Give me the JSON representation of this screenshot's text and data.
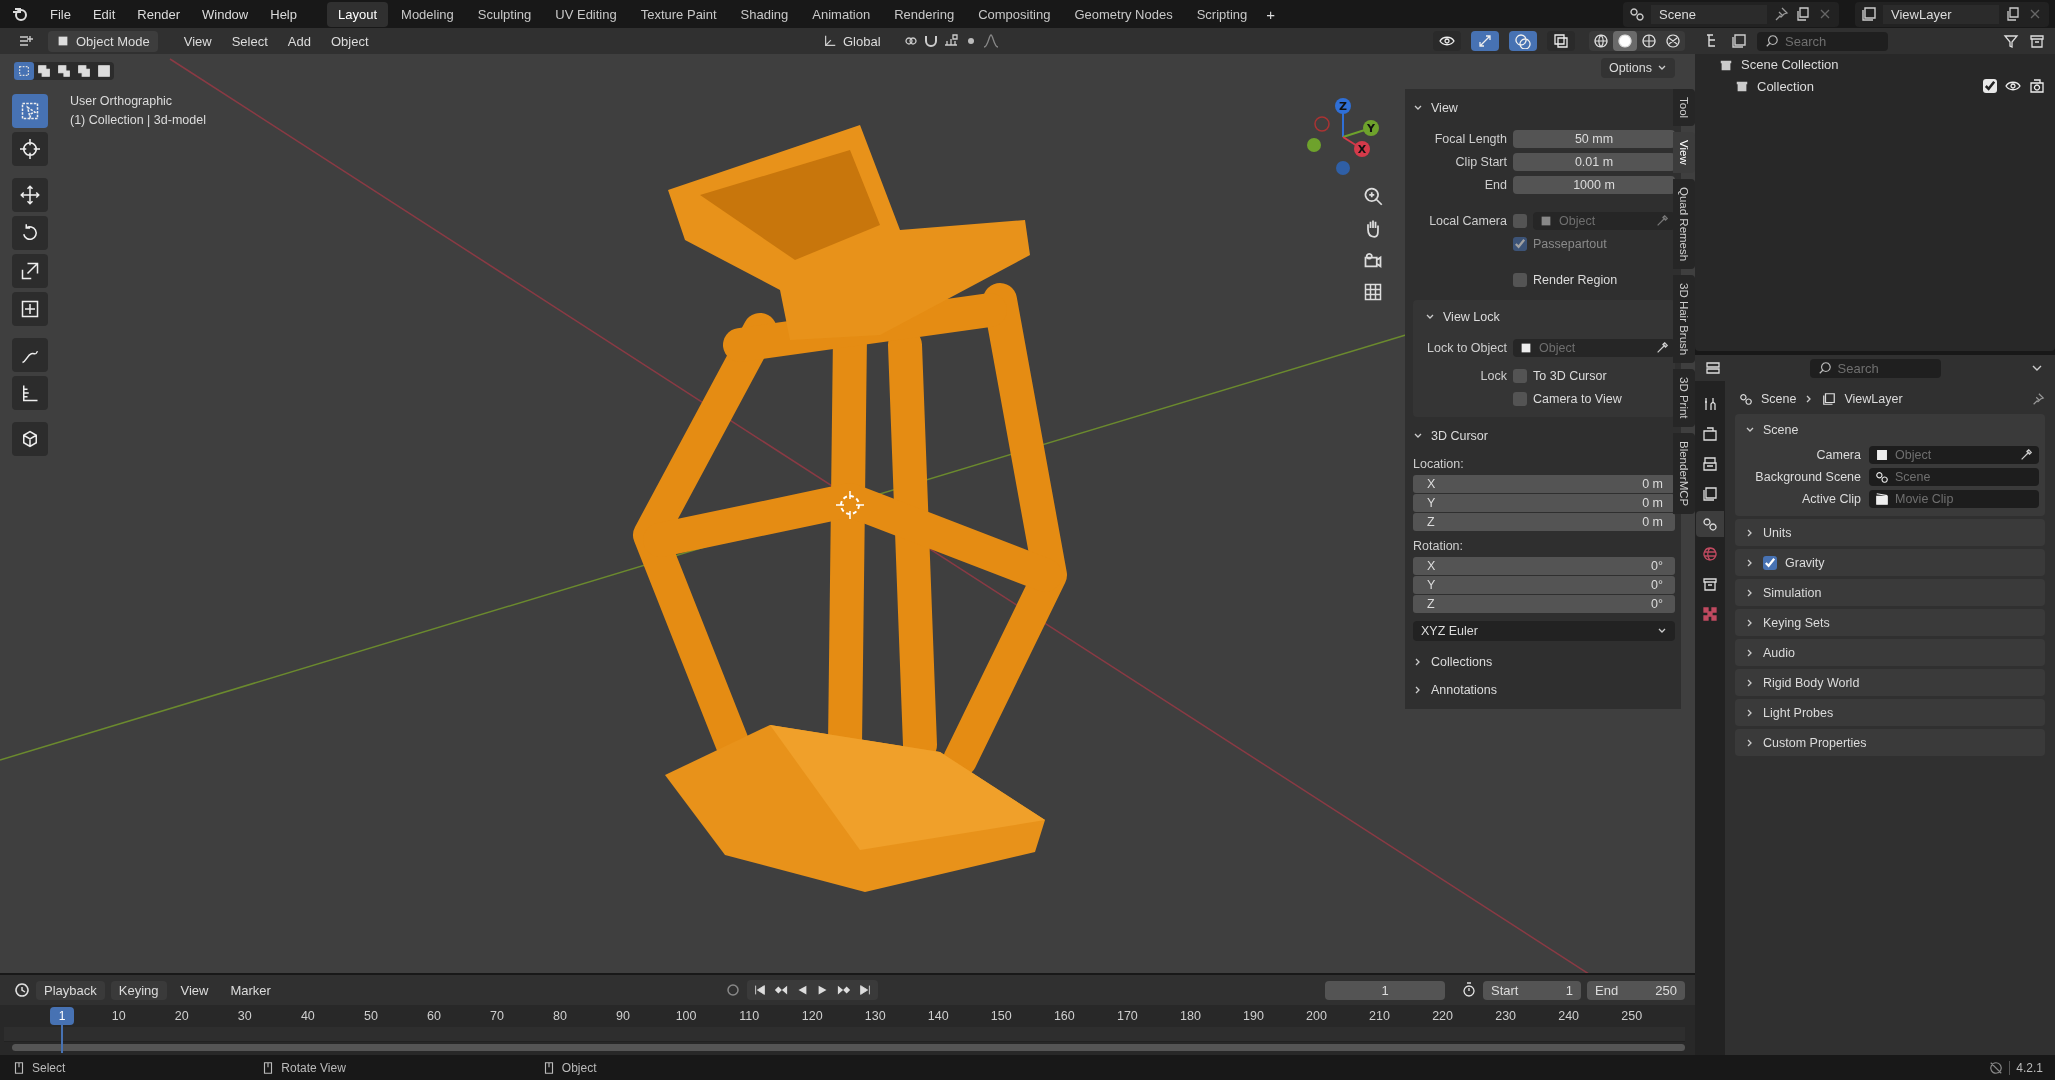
{
  "top_bar": {
    "menus": [
      "File",
      "Edit",
      "Render",
      "Window",
      "Help"
    ],
    "workspaces": [
      {
        "label": "Layout",
        "selected": true
      },
      {
        "label": "Modeling",
        "selected": false
      },
      {
        "label": "Sculpting",
        "selected": false
      },
      {
        "label": "UV Editing",
        "selected": false
      },
      {
        "label": "Texture Paint",
        "selected": false
      },
      {
        "label": "Shading",
        "selected": false
      },
      {
        "label": "Animation",
        "selected": false
      },
      {
        "label": "Rendering",
        "selected": false
      },
      {
        "label": "Compositing",
        "selected": false
      },
      {
        "label": "Geometry Nodes",
        "selected": false
      },
      {
        "label": "Scripting",
        "selected": false
      }
    ],
    "add_workspace": "+",
    "scene": "Scene",
    "view_layer": "ViewLayer"
  },
  "viewport_header": {
    "mode": "Object Mode",
    "menus": [
      "View",
      "Select",
      "Add",
      "Object"
    ],
    "orientation": "Global",
    "toggles": [
      {
        "kind": "visibility",
        "on": false
      },
      {
        "kind": "gizmos",
        "on": true
      },
      {
        "kind": "overlays",
        "on": true
      },
      {
        "kind": "xray",
        "on": false
      }
    ],
    "shading": [
      {
        "kind": "wireframe",
        "selected": false
      },
      {
        "kind": "solid",
        "selected": true
      },
      {
        "kind": "material",
        "selected": false
      },
      {
        "kind": "rendered",
        "selected": false
      }
    ],
    "options": "Options"
  },
  "select_modes": [
    {
      "kind": "new",
      "selected": true
    },
    {
      "kind": "extend",
      "selected": false
    },
    {
      "kind": "subtract",
      "selected": false
    },
    {
      "kind": "invert",
      "selected": false
    },
    {
      "kind": "intersect",
      "selected": false
    }
  ],
  "tools": [
    {
      "kind": "select_box",
      "selected": true
    },
    {
      "kind": "cursor",
      "selected": false
    },
    {
      "kind": "move",
      "selected": false
    },
    {
      "kind": "rotate",
      "selected": false
    },
    {
      "kind": "scale",
      "selected": false
    },
    {
      "kind": "transform",
      "selected": false
    },
    {
      "kind": "annotate",
      "selected": false
    },
    {
      "kind": "measure",
      "selected": false
    },
    {
      "kind": "add_cube",
      "selected": false
    }
  ],
  "viewport": {
    "view_name": "User Orthographic",
    "object_info": "(1) Collection | 3d-model",
    "gizmo": {
      "z": "Z",
      "y": "Y",
      "x": "X"
    }
  },
  "sidebar": {
    "tabs": [
      {
        "label": "Tool",
        "selected": false
      },
      {
        "label": "View",
        "selected": true
      },
      {
        "label": "Quad Remesh",
        "selected": false
      },
      {
        "label": "3D Hair Brush",
        "selected": false
      },
      {
        "label": "3D Print",
        "selected": false
      },
      {
        "label": "BlenderMCP",
        "selected": false
      }
    ],
    "view": {
      "title": "View",
      "expanded": true,
      "fields": [
        {
          "label": "Focal Length",
          "value": "50 mm"
        },
        {
          "label": "Clip Start",
          "value": "0.01 m"
        },
        {
          "label": "End",
          "value": "1000 m"
        }
      ],
      "local_camera": {
        "label": "Local Camera",
        "checked": false,
        "placeholder": "Object"
      },
      "passepartout": {
        "label": "Passepartout",
        "checked": true,
        "disabled": true
      },
      "render_region": {
        "label": "Render Region",
        "checked": false
      }
    },
    "view_lock": {
      "title": "View Lock",
      "expanded": true,
      "object_label": "Lock to Object",
      "object_placeholder": "Object",
      "lock_label": "Lock",
      "options": [
        {
          "label": "To 3D Cursor",
          "checked": false
        },
        {
          "label": "Camera to View",
          "checked": false
        }
      ]
    },
    "cursor": {
      "title": "3D Cursor",
      "expanded": true,
      "location_label": "Location:",
      "location": [
        {
          "axis": "X",
          "value": "0 m"
        },
        {
          "axis": "Y",
          "value": "0 m"
        },
        {
          "axis": "Z",
          "value": "0 m"
        }
      ],
      "rotation_label": "Rotation:",
      "rotation": [
        {
          "axis": "X",
          "value": "0°"
        },
        {
          "axis": "Y",
          "value": "0°"
        },
        {
          "axis": "Z",
          "value": "0°"
        }
      ],
      "rotation_mode": "XYZ Euler"
    },
    "collapsed": [
      {
        "title": "Collections",
        "expanded": false
      },
      {
        "title": "Annotations",
        "expanded": false
      }
    ]
  },
  "outliner": {
    "search_placeholder": "Search",
    "tree": [
      {
        "label": "Scene Collection",
        "children": [
          {
            "label": "Collection",
            "checked": true
          }
        ]
      }
    ]
  },
  "properties": {
    "search_placeholder": "Search",
    "tabs": [
      {
        "kind": "tool",
        "selected": false
      },
      {
        "kind": "render",
        "selected": false
      },
      {
        "kind": "output",
        "selected": false
      },
      {
        "kind": "view_layer",
        "selected": false
      },
      {
        "kind": "scene",
        "selected": true
      },
      {
        "kind": "world",
        "selected": false
      },
      {
        "kind": "collection",
        "selected": false
      },
      {
        "kind": "texture",
        "selected": false
      }
    ],
    "breadcrumb": [
      "Scene",
      "ViewLayer"
    ],
    "scene_panel": {
      "title": "Scene",
      "expanded": true,
      "fields": [
        {
          "kind": "object",
          "label": "Camera",
          "placeholder": "Object"
        },
        {
          "kind": "scene",
          "label": "Background Scene",
          "placeholder": "Scene"
        },
        {
          "kind": "clip",
          "label": "Active Clip",
          "placeholder": "Movie Clip"
        }
      ]
    },
    "panels": [
      {
        "title": "Units",
        "kind": "plain"
      },
      {
        "title": "Gravity",
        "kind": "toggle",
        "checked": true
      },
      {
        "title": "Simulation",
        "kind": "plain"
      },
      {
        "title": "Keying Sets",
        "kind": "plain"
      },
      {
        "title": "Audio",
        "kind": "plain"
      },
      {
        "title": "Rigid Body World",
        "kind": "plain"
      },
      {
        "title": "Light Probes",
        "kind": "plain"
      },
      {
        "title": "Custom Properties",
        "kind": "plain"
      }
    ]
  },
  "timeline": {
    "menus": [
      "Playback",
      "Keying",
      "View",
      "Marker"
    ],
    "current_frame": "1",
    "start_label": "Start",
    "start": "1",
    "end_label": "End",
    "end": "250",
    "playhead": "1",
    "ticks": [
      "10",
      "20",
      "30",
      "40",
      "50",
      "60",
      "70",
      "80",
      "90",
      "100",
      "110",
      "120",
      "130",
      "140",
      "150",
      "160",
      "170",
      "180",
      "190",
      "200",
      "210",
      "220",
      "230",
      "240",
      "250"
    ]
  },
  "status_bar": {
    "hints": [
      "Select",
      "Rotate View",
      "Object"
    ],
    "version": "4.2.1"
  }
}
